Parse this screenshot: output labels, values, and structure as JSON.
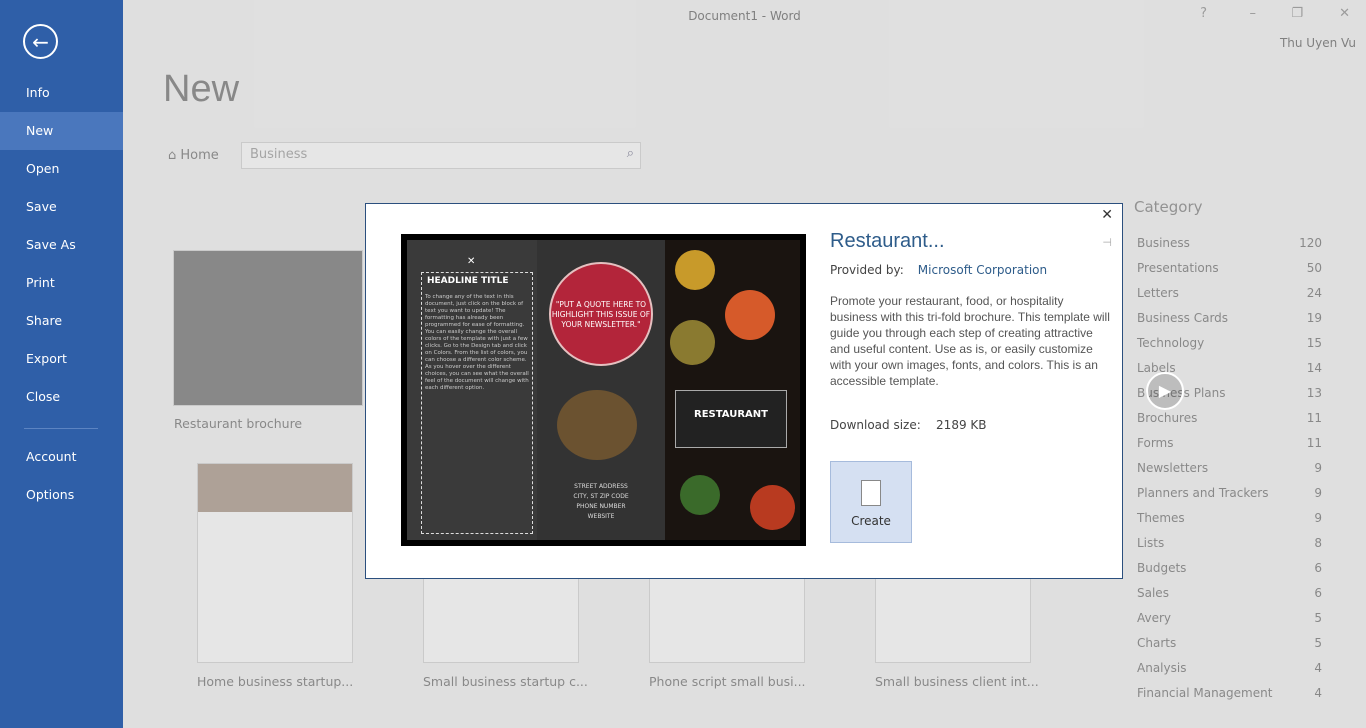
{
  "window": {
    "title": "Document1 - Word",
    "user": "Thu Uyen Vu",
    "help": "?",
    "minimize": "–",
    "restore": "❐",
    "close": "✕"
  },
  "sidebar": {
    "back": "←",
    "items": [
      {
        "label": "Info"
      },
      {
        "label": "New",
        "selected": true
      },
      {
        "label": "Open"
      },
      {
        "label": "Save"
      },
      {
        "label": "Save As"
      },
      {
        "label": "Print"
      },
      {
        "label": "Share"
      },
      {
        "label": "Export"
      },
      {
        "label": "Close"
      },
      {
        "label": "Account"
      },
      {
        "label": "Options"
      }
    ]
  },
  "main": {
    "title": "New",
    "home": "Home",
    "search_value": "Business",
    "templates": [
      {
        "label": "Restaurant brochure"
      },
      {
        "label": "Home business startup..."
      },
      {
        "label": "Small business startup c..."
      },
      {
        "label": "Phone script small busi..."
      },
      {
        "label": "Small business client int..."
      }
    ]
  },
  "category": {
    "title": "Category",
    "items": [
      {
        "label": "Business",
        "count": "120"
      },
      {
        "label": "Presentations",
        "count": "50"
      },
      {
        "label": "Letters",
        "count": "24"
      },
      {
        "label": "Business Cards",
        "count": "19"
      },
      {
        "label": "Technology",
        "count": "15"
      },
      {
        "label": "Labels",
        "count": "14"
      },
      {
        "label": "Business Plans",
        "count": "13"
      },
      {
        "label": "Brochures",
        "count": "11"
      },
      {
        "label": "Forms",
        "count": "11"
      },
      {
        "label": "Newsletters",
        "count": "9"
      },
      {
        "label": "Planners and Trackers",
        "count": "9"
      },
      {
        "label": "Themes",
        "count": "9"
      },
      {
        "label": "Lists",
        "count": "8"
      },
      {
        "label": "Budgets",
        "count": "6"
      },
      {
        "label": "Sales",
        "count": "6"
      },
      {
        "label": "Avery",
        "count": "5"
      },
      {
        "label": "Charts",
        "count": "5"
      },
      {
        "label": "Analysis",
        "count": "4"
      },
      {
        "label": "Financial Management",
        "count": "4"
      }
    ]
  },
  "dialog": {
    "title": "Restaurant...",
    "provided_by_label": "Provided by:",
    "provider": "Microsoft Corporation",
    "description": "Promote your restaurant, food, or hospitality business with this tri-fold brochure.  This template will guide you through each step of creating attractive and useful content. Use as is, or easily customize with your own images, fonts, and colors. This is an accessible template.",
    "download_label": "Download size:",
    "download_size": "2189 KB",
    "create": "Create",
    "close": "✕",
    "preview": {
      "headline": "HEADLINE TITLE",
      "body": "To change any of the text in this document, just click on the block of text you want to update! The formatting has already been programmed for ease of formatting. You can easily change the overall colors of the template with just a few clicks. Go to the Design tab and click on Colors. From the list of colors, you can choose a different color scheme. As you hover over the different choices, you can see what the overall feel of the document will change with each different option.",
      "quote": "\"PUT A QUOTE HERE TO HIGHLIGHT THIS ISSUE OF YOUR NEWSLETTER.\"",
      "address": "STREET ADDRESS\nCITY, ST ZIP CODE\nPHONE NUMBER\nWEBSITE",
      "logo": "RESTAURANT"
    }
  }
}
